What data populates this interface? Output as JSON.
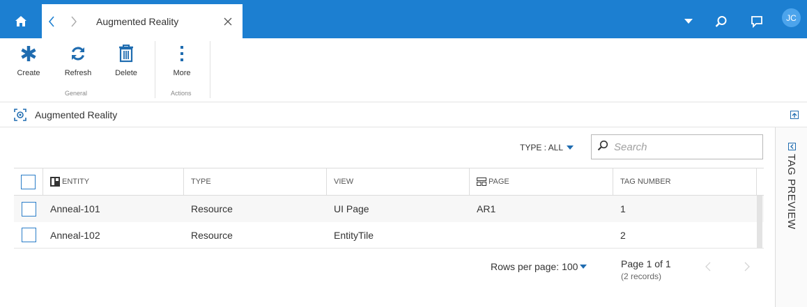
{
  "colors": {
    "topbar": "#1c7fd1",
    "link": "#1f6cb0",
    "checkbox": "#2a7dc8",
    "avatar": "#4ca4ec"
  },
  "topbar": {
    "tab_title": "Augmented Reality",
    "avatar_initials": "JC",
    "icons": [
      "home-icon",
      "chevron-left-icon",
      "chevron-right-icon",
      "close-icon",
      "caret-down-icon",
      "search-icon",
      "chat-icon"
    ]
  },
  "ribbon": {
    "buttons": [
      {
        "label": "Create",
        "icon": "asterisk-icon"
      },
      {
        "label": "Refresh",
        "icon": "refresh-icon"
      },
      {
        "label": "Delete",
        "icon": "trash-icon"
      },
      {
        "label": "More",
        "icon": "more-vertical-icon"
      }
    ],
    "groups": [
      "General",
      "Actions"
    ]
  },
  "section": {
    "title": "Augmented Reality",
    "icon": "ar-target-icon"
  },
  "toolbar": {
    "type_filter": "TYPE : ALL",
    "search_placeholder": "Search"
  },
  "grid": {
    "columns": [
      "ENTITY",
      "TYPE",
      "VIEW",
      "PAGE",
      "TAG NUMBER"
    ],
    "rows": [
      {
        "entity": "Anneal-101",
        "type": "Resource",
        "view": "UI Page",
        "page": "AR1",
        "tag_number": "1"
      },
      {
        "entity": "Anneal-102",
        "type": "Resource",
        "view": "EntityTile",
        "page": "",
        "tag_number": "2"
      }
    ]
  },
  "pager": {
    "rows_per_page_label": "Rows per page:",
    "rows_per_page_value": "100",
    "page_info": "Page 1 of 1",
    "records": "(2 records)"
  },
  "side_panel": {
    "label": "TAG PREVIEW"
  }
}
